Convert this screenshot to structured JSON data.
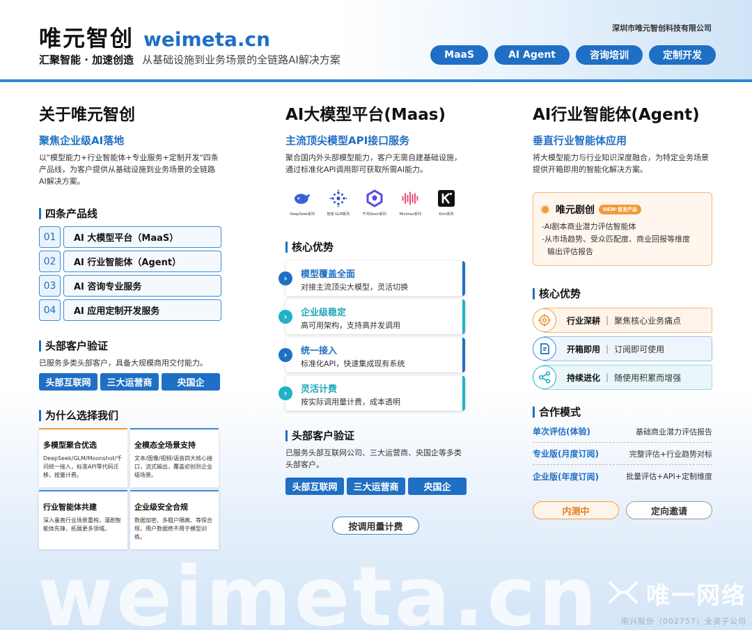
{
  "header": {
    "brand_cn": "唯元智创",
    "brand_url": "weimeta.cn",
    "slogan_bold": "汇聚智能 · 加速创造",
    "slogan_text": "从基础设施到业务场景的全链路AI解决方案",
    "company": "深圳市唯元智创科技有限公司",
    "pills": [
      "MaaS",
      "AI Agent",
      "咨询培训",
      "定制开发"
    ]
  },
  "about": {
    "title": "关于唯元智创",
    "subtitle": "聚焦企业级AI落地",
    "desc": "以\"模型能力+行业智能体+专业服务+定制开发\"四条产品线，为客户提供从基础设施到业务场景的全链路AI解决方案。",
    "products_title": "四条产品线",
    "products": [
      {
        "num": "01",
        "label": "AI 大模型平台（MaaS）"
      },
      {
        "num": "02",
        "label": "AI 行业智能体（Agent）"
      },
      {
        "num": "03",
        "label": "AI 咨询专业服务"
      },
      {
        "num": "04",
        "label": "AI 应用定制开发服务"
      }
    ],
    "clients_title": "头部客户验证",
    "clients_desc": "已服务多类头部客户，具备大规模商用交付能力。",
    "clients_tags": [
      "头部互联网",
      "三大运营商",
      "央国企"
    ],
    "why_title": "为什么选择我们",
    "why_cards": [
      {
        "title": "多模型聚合优选",
        "text": "DeepSeek/GLM/Moonshot/千问统一接入，标准API零代码迁移，按量计费。"
      },
      {
        "title": "全模态全场景支持",
        "text": "文本/图像/视频/语音四大核心接口，流式输出，覆盖初创到企业级场景。"
      },
      {
        "title": "行业智能体共建",
        "text": "深入垂直行业场景重构，漫剧智能体先锋，拓展更多领域。"
      },
      {
        "title": "企业级安全合规",
        "text": "数据加密、多租户隔离、等保合规，用户数据绝不用于模型训练。"
      }
    ]
  },
  "maas": {
    "title": "AI大模型平台(Maas)",
    "subtitle": "主流顶尖模型API接口服务",
    "desc": "聚合国内外头部模型能力，客户无需自建基础设施，通过标准化API调用即可获取所需AI能力。",
    "logos": [
      {
        "name": "DeepSeek系列",
        "icon": "deepseek-whale-icon"
      },
      {
        "name": "智谱 GLM系列",
        "icon": "glm-dots-icon"
      },
      {
        "name": "千问Qwen系列",
        "icon": "qwen-icon"
      },
      {
        "name": "Minimax系列",
        "icon": "minimax-wave-icon"
      },
      {
        "name": "Kimi系列",
        "icon": "kimi-k-icon"
      }
    ],
    "adv_title": "核心优势",
    "advantages": [
      {
        "title": "模型覆盖全面",
        "text": "对接主流顶尖大模型，灵活切换"
      },
      {
        "title": "企业级稳定",
        "text": "高可用架构，支持高并发调用"
      },
      {
        "title": "统一接入",
        "text": "标准化API，快速集成现有系统"
      },
      {
        "title": "灵活计费",
        "text": "按实际调用量计费，成本透明"
      }
    ],
    "clients_title": "头部客户验证",
    "clients_desc": "已服务头部互联网公司、三大运营商、央国企等多类头部客户。",
    "clients_tags": [
      "头部互联网",
      "三大运营商",
      "央国企"
    ],
    "billing_button": "按调用量计费"
  },
  "agent": {
    "title": "AI行业智能体(Agent)",
    "subtitle": "垂直行业智能体应用",
    "desc": "将大模型能力与行业知识深度融合，为特定业务场景提供开箱即用的智能化解决方案。",
    "feature": {
      "title": "唯元剧创",
      "badge": "NEW·首发产品",
      "line1": "-AI剧本商业潜力评估智能体",
      "line2": "-从市场趋势、受众匹配度、商业回报等维度",
      "line3": "输出评估报告"
    },
    "adv_title": "核心优势",
    "advantages": [
      {
        "title": "行业深耕",
        "text": "聚焦核心业务痛点",
        "icon": "target-icon"
      },
      {
        "title": "开箱即用",
        "text": "订阅即可使用",
        "icon": "document-icon"
      },
      {
        "title": "持续进化",
        "text": "随使用积累而增强",
        "icon": "share-network-icon"
      }
    ],
    "modes_title": "合作模式",
    "modes": [
      {
        "name": "单次评估(体验)",
        "desc": "基础商业潜力评估报告"
      },
      {
        "name": "专业版(月度订阅)",
        "desc": "完整评估+行业趋势对标"
      },
      {
        "name": "企业版(年度订阅)",
        "desc": "批量评估+API+定制维度"
      }
    ],
    "btn_testing": "内测中",
    "btn_invite": "定向邀请"
  },
  "watermark": {
    "text": "weimeta.cn",
    "logo_name": "唯一网络",
    "logo_sub": "南兴股份（002757）全资子公司"
  },
  "colors": {
    "brand_blue": "#1f6fc4",
    "accent_teal": "#1fb2c8",
    "accent_orange": "#f39a3a"
  }
}
